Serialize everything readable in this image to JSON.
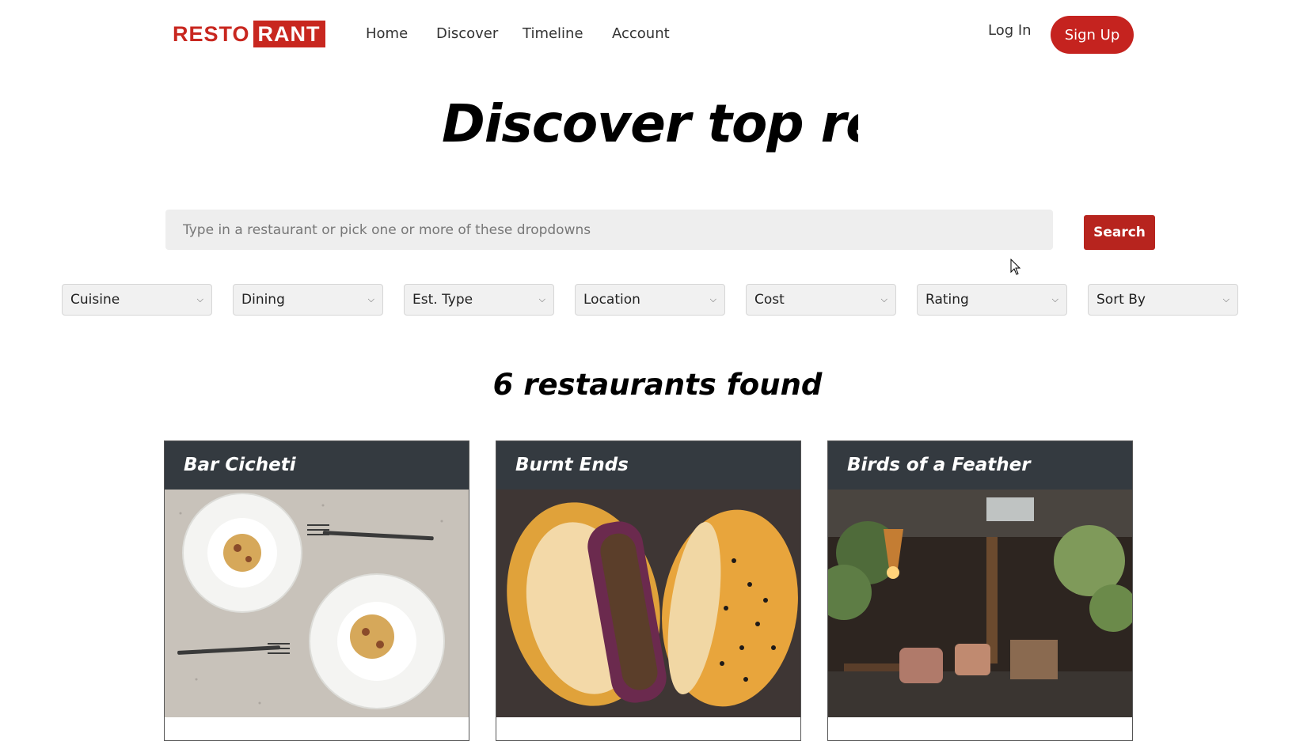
{
  "nav": {
    "logo_part1": "RESTO",
    "logo_part2": "RANT",
    "links": [
      "Home",
      "Discover",
      "Timeline",
      "Account"
    ],
    "login": "Log In",
    "signup": "Sign Up"
  },
  "hero": {
    "title": "Discover top restaurants"
  },
  "search": {
    "placeholder": "Type in a restaurant or pick one or more of these dropdowns",
    "button": "Search"
  },
  "filters": [
    "Cuisine",
    "Dining",
    "Est. Type",
    "Location",
    "Cost",
    "Rating",
    "Sort By"
  ],
  "results": {
    "count_text": "6 restaurants found",
    "cards": [
      {
        "name": "Bar Cicheti"
      },
      {
        "name": "Burnt Ends"
      },
      {
        "name": "Birds of a Feather"
      }
    ]
  },
  "colors": {
    "brand_red": "#c5231f",
    "card_header": "#343a40"
  }
}
